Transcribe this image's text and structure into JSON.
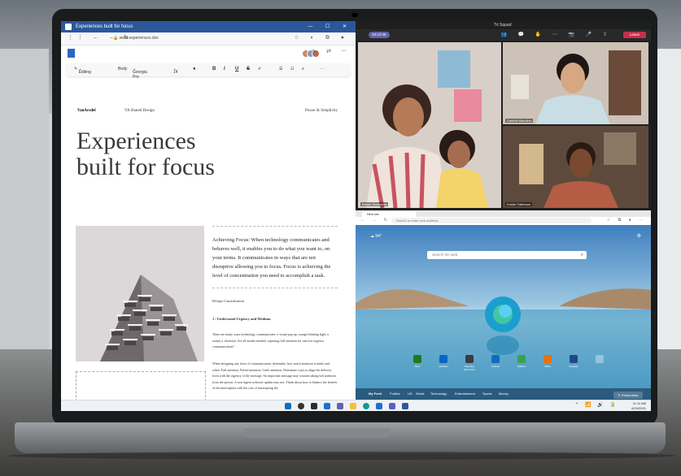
{
  "word": {
    "window_title": "Experiences built for focus",
    "window_controls": "— ☐ ✕",
    "address": "www.experiences.doc",
    "toolbar": {
      "editing": "Editing",
      "style": "Body",
      "font": "Georgia Pro",
      "size": "14",
      "bold": "B",
      "italic": "I",
      "underline": "U",
      "strike": "S",
      "more": "···"
    },
    "doc": {
      "brand": "VanArsdel",
      "header_mid": "VA Shared Design",
      "header_right": "Power & Simplicity",
      "heading_line1": "Experiences",
      "heading_line2": "built for focus",
      "lead": "Achieving Focus: When technology communicates and behaves well, it enables you to do what you want to, on your terms. It communicates in ways that are not disruptive allowing you to focus. Focus is achieving the level of concentration you need to accomplish a task.",
      "section_label": "Design Consideration",
      "section_title": "1 / Understand Urgency and Medium",
      "para1": "There are many ways technology communicates: a visual pop up, orange blinking light, a sound, a vibration. Are all modes needed, capturing full attention for one low urgency communication?",
      "para2": "When designing any form of communication, determine, how much attention it needs and when. Full attention, Partial attention, Little attention. Determine ways to align the delivery form with the urgency of the message. An important message may warrant taking full attention from the person. A non urgent software update may not. Think about how to balance the benefit of the interruption with the cost of interrupting the"
    }
  },
  "teams": {
    "title": "Tri Squad",
    "timer": "03:23:35",
    "leave_label": "Leave",
    "participants": [
      {
        "name": "Babak Shammas"
      },
      {
        "name": "Daniela Mandera"
      },
      {
        "name": "Kristin Patterson"
      }
    ]
  },
  "edge": {
    "tab_label": "New tab",
    "url_placeholder": "Search or enter web address",
    "weather": "☁ 54°",
    "search_placeholder": "Search the web",
    "tiles": [
      {
        "label": "Xbox",
        "color": "#1f7a1f"
      },
      {
        "label": "LinkedIn",
        "color": "#0a66c2"
      },
      {
        "label": "Planning Document",
        "color": "#3b3b3b"
      },
      {
        "label": "Outlook",
        "color": "#0f6cbd"
      },
      {
        "label": "Mailbox",
        "color": "#38a34a"
      },
      {
        "label": "Office",
        "color": "#e3730f"
      },
      {
        "label": "Expedia",
        "color": "#1e4a8a"
      }
    ],
    "feed_tabs": [
      "My Feed",
      "Politics",
      "US",
      "World",
      "Technology",
      "Entertainment",
      "Sports",
      "Money"
    ],
    "personalize_label": "✎ Personalize"
  },
  "taskbar": {
    "time": "11:11 AM",
    "date": "6/24/2021",
    "apps": [
      {
        "name": "start",
        "color": "#0f6cbd"
      },
      {
        "name": "search",
        "color": "#333333"
      },
      {
        "name": "task-view",
        "color": "#2d2d2d"
      },
      {
        "name": "widgets",
        "color": "#1a73c9"
      },
      {
        "name": "chat",
        "color": "#6264a7"
      },
      {
        "name": "file-explorer",
        "color": "#f3c13a"
      },
      {
        "name": "edge",
        "color": "#0f9d8f"
      },
      {
        "name": "store",
        "color": "#1f6fd1"
      },
      {
        "name": "teams",
        "color": "#5b5fc7"
      },
      {
        "name": "word",
        "color": "#2b579a"
      }
    ]
  }
}
